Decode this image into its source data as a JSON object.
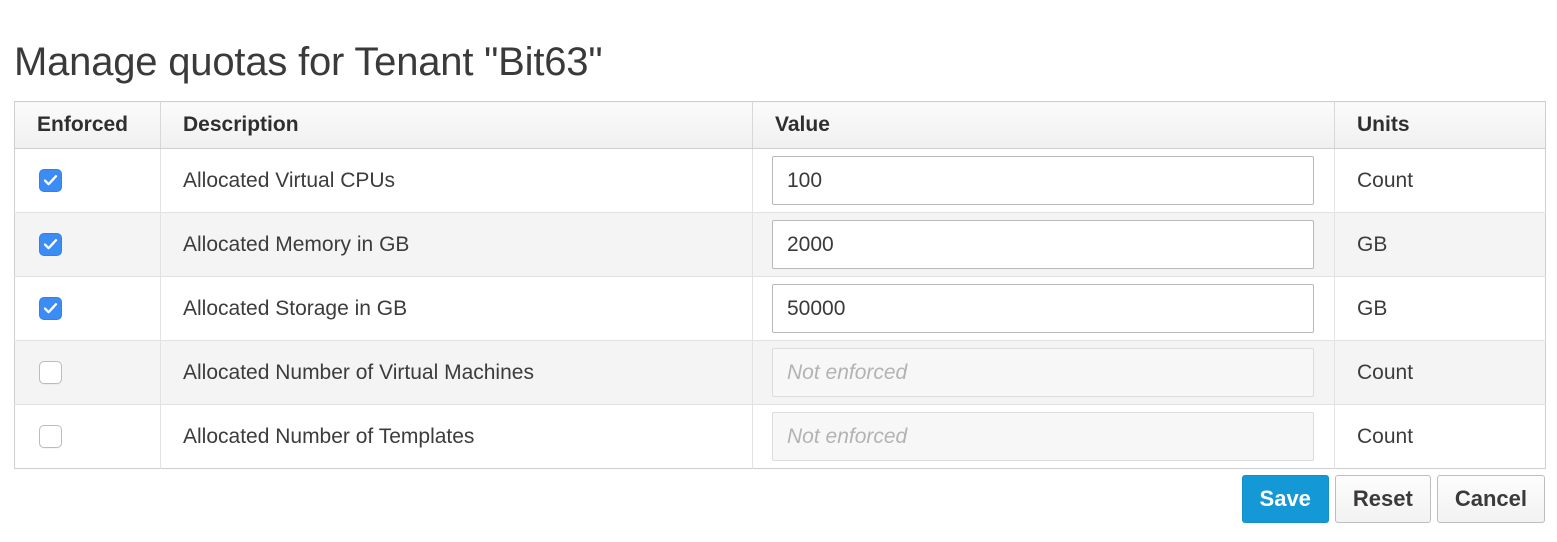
{
  "page_title": "Manage quotas for Tenant \"Bit63\"",
  "table": {
    "columns": [
      {
        "key": "enforced",
        "label": "Enforced"
      },
      {
        "key": "description",
        "label": "Description"
      },
      {
        "key": "value",
        "label": "Value"
      },
      {
        "key": "units",
        "label": "Units"
      }
    ],
    "rows": [
      {
        "enforced": true,
        "description": "Allocated Virtual CPUs",
        "value": "100",
        "placeholder": "",
        "units": "Count"
      },
      {
        "enforced": true,
        "description": "Allocated Memory in GB",
        "value": "2000",
        "placeholder": "",
        "units": "GB"
      },
      {
        "enforced": true,
        "description": "Allocated Storage in GB",
        "value": "50000",
        "placeholder": "",
        "units": "GB"
      },
      {
        "enforced": false,
        "description": "Allocated Number of Virtual Machines",
        "value": "",
        "placeholder": "Not enforced",
        "units": "Count"
      },
      {
        "enforced": false,
        "description": "Allocated Number of Templates",
        "value": "",
        "placeholder": "Not enforced",
        "units": "Count"
      }
    ]
  },
  "buttons": {
    "save": "Save",
    "reset": "Reset",
    "cancel": "Cancel"
  },
  "colors": {
    "primary_button": "#1499d6",
    "checkbox_accent": "#3b8cf5",
    "table_border": "#cfcfcf",
    "row_stripe": "#f4f4f4"
  }
}
